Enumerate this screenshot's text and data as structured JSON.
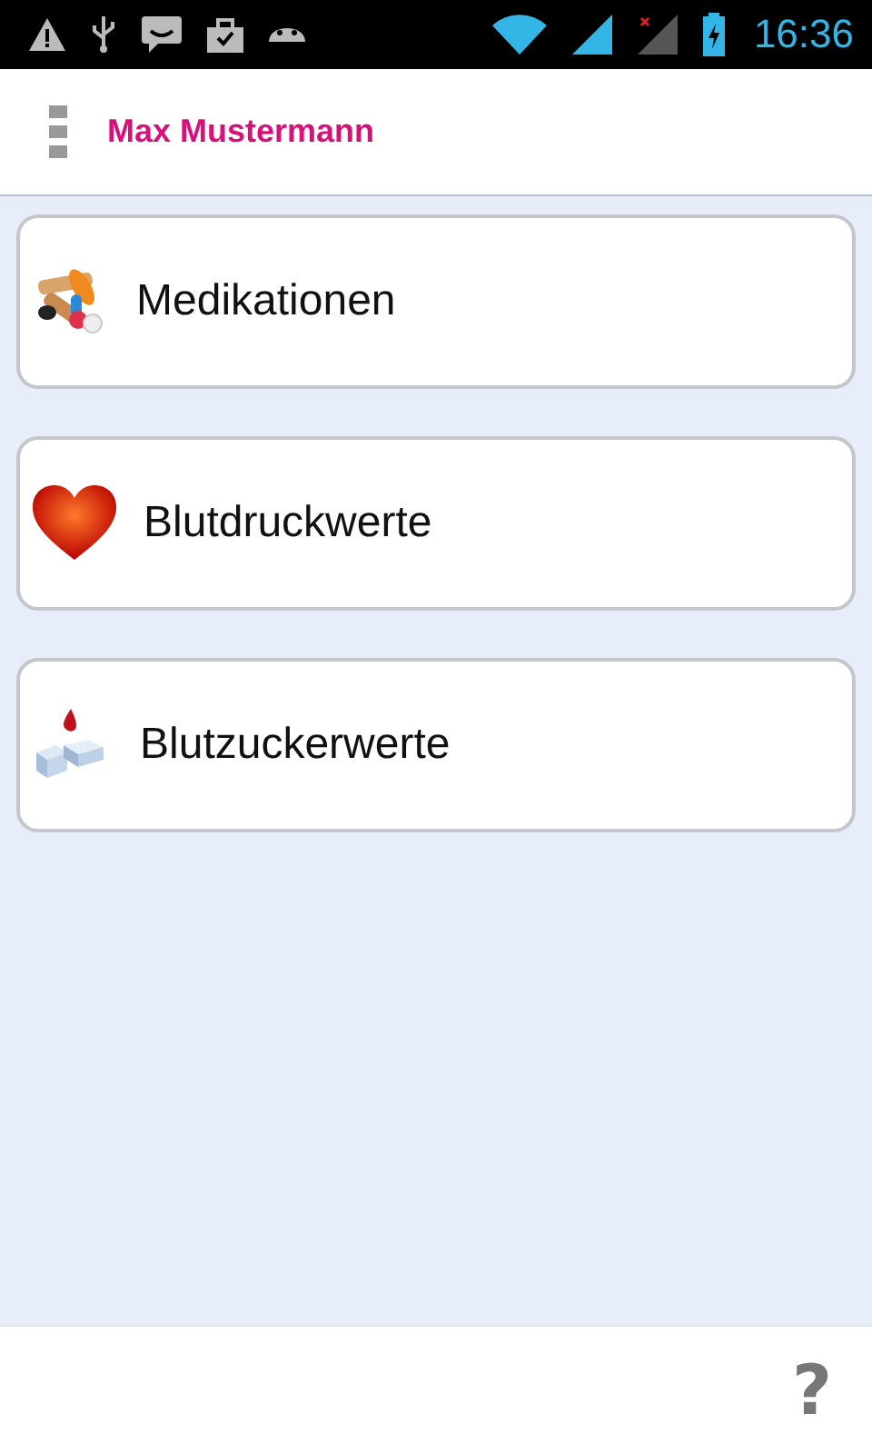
{
  "status_bar": {
    "time": "16:36"
  },
  "header": {
    "title": "Max Mustermann"
  },
  "menu_items": [
    {
      "label": "Medikationen",
      "kind": "pills"
    },
    {
      "label": "Blutdruckwerte",
      "kind": "heart"
    },
    {
      "label": "Blutzuckerwerte",
      "kind": "sugar"
    }
  ],
  "footer": {
    "help": "?"
  }
}
